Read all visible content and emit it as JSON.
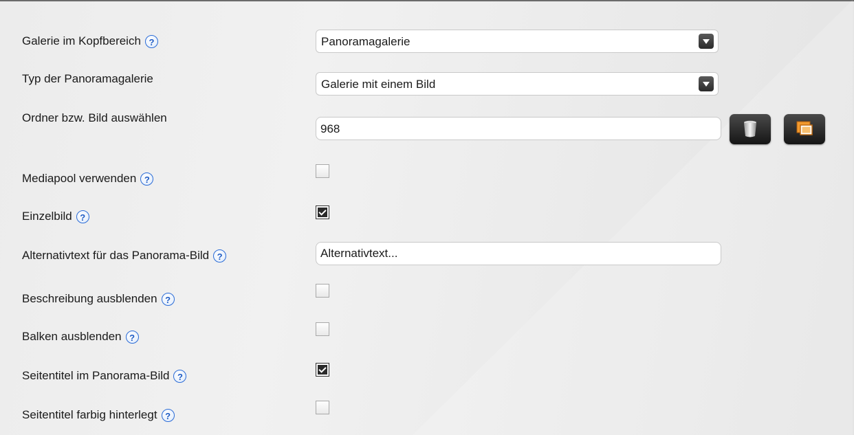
{
  "help_symbol": "?",
  "fields": {
    "gallery_header": {
      "label": "Galerie im Kopfbereich",
      "value": "Panoramagalerie"
    },
    "gallery_type": {
      "label": "Typ der Panoramagalerie",
      "value": "Galerie mit einem Bild"
    },
    "folder_image": {
      "label": "Ordner bzw. Bild auswählen",
      "value": "968"
    },
    "mediapool": {
      "label": "Mediapool verwenden",
      "checked": false
    },
    "single_image": {
      "label": "Einzelbild",
      "checked": true
    },
    "alt_text": {
      "label": "Alternativtext für das Panorama-Bild",
      "value": "Alternativtext..."
    },
    "hide_description": {
      "label": "Beschreibung ausblenden",
      "checked": false
    },
    "hide_bar": {
      "label": "Balken ausblenden",
      "checked": false
    },
    "page_title_in_image": {
      "label": "Seitentitel im Panorama-Bild",
      "checked": true
    },
    "page_title_colored": {
      "label": "Seitentitel farbig hinterlegt",
      "checked": false
    }
  },
  "icons": {
    "delete": "trash-icon",
    "browse": "image-browse-icon"
  },
  "colors": {
    "help_icon": "#2a6bd6",
    "button_dark": "#1e1e1e",
    "browse_icon_accent": "#f08a1c"
  }
}
